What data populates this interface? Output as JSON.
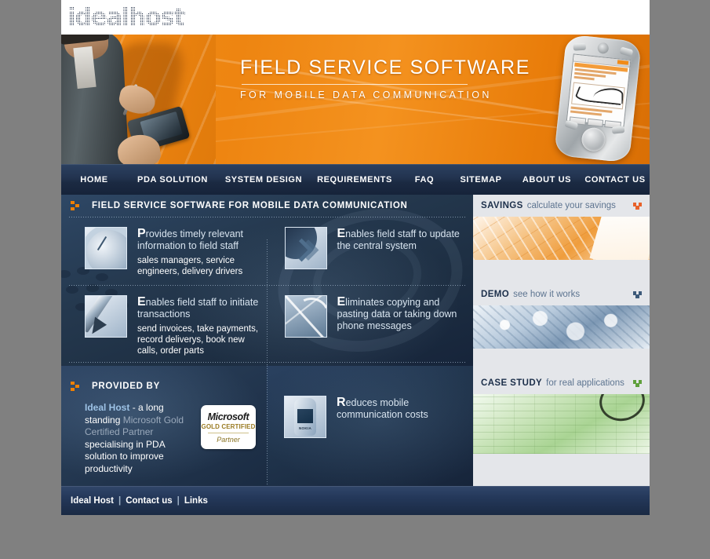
{
  "site": {
    "logo_text": "idealhost"
  },
  "banner": {
    "title": "FIELD SERVICE SOFTWARE",
    "subtitle": "FOR MOBILE DATA COMMUNICATION",
    "device_label": "NOKIA"
  },
  "nav": {
    "items": [
      {
        "label": "HOME",
        "name": "nav-home"
      },
      {
        "label": "PDA SOLUTION",
        "name": "nav-pda-solution"
      },
      {
        "label": "SYSTEM DESIGN",
        "name": "nav-system-design"
      },
      {
        "label": "REQUIREMENTS",
        "name": "nav-requirements"
      },
      {
        "label": "FAQ",
        "name": "nav-faq"
      },
      {
        "label": "SITEMAP",
        "name": "nav-sitemap"
      },
      {
        "label": "ABOUT US",
        "name": "nav-about-us"
      },
      {
        "label": "CONTACT US",
        "name": "nav-contact-us"
      }
    ]
  },
  "main": {
    "heading": "FIELD SERVICE SOFTWARE FOR MOBILE DATA COMMUNICATION",
    "features": [
      {
        "cap": "P",
        "title": "rovides timely relevant information to field staff",
        "sub": "sales managers, service engineers, delivery drivers",
        "icon": "clock-icon"
      },
      {
        "cap": "E",
        "title": "nables field staff to update the central system",
        "sub": "",
        "icon": "arrows-icon"
      },
      {
        "cap": "E",
        "title": "nables field staff to initiate transactions",
        "sub": "send invoices, take payments, record deliverys, book new calls, order parts",
        "icon": "pen-icon"
      },
      {
        "cap": "E",
        "title": "liminates copying and pasting data or taking down phone messages",
        "sub": "",
        "icon": "map-icon"
      }
    ],
    "nokia_feature": {
      "cap": "R",
      "title": "educes mobile communication costs",
      "icon": "nokia-phone-icon"
    }
  },
  "provided_by": {
    "heading": "PROVIDED BY",
    "text_1": "Ideal Host",
    "text_2": " - a long standing ",
    "text_3": "Microsoft Gold Certified Partner",
    "text_4": " specialising in PDA solution to improve productivity",
    "badge": {
      "line1": "Microsoft",
      "line2": "GOLD CERTIFIED",
      "line3": "Partner"
    }
  },
  "sidebar": {
    "panels": [
      {
        "strong": "SAVINGS",
        "soft": "calculate your savings",
        "chevron_color": "#e8622a",
        "image": "savings-blueprint-image"
      },
      {
        "strong": "DEMO",
        "soft": "see how it works",
        "chevron_color": "#3d5a7a",
        "image": "demo-gears-image"
      },
      {
        "strong": "CASE STUDY",
        "soft": "for real applications",
        "chevron_color": "#5fa03c",
        "image": "case-study-spreadsheet-image"
      }
    ]
  },
  "footer": {
    "links": [
      {
        "label": "Ideal Host",
        "name": "footer-link-ideal-host"
      },
      {
        "label": "Contact us",
        "name": "footer-link-contact-us"
      },
      {
        "label": "Links",
        "name": "footer-link-links"
      }
    ],
    "separator": "|"
  },
  "colors": {
    "accent_orange": "#f08000",
    "nav_blue": "#1b2a42",
    "panel_bg": "#e4e6ea"
  }
}
